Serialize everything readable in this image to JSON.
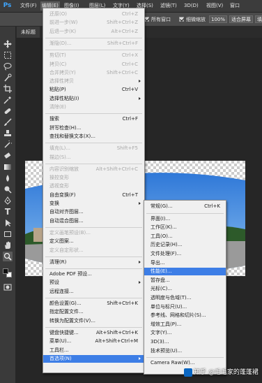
{
  "app_logo": "Ps",
  "menubar": {
    "items": [
      {
        "name": "menu-file",
        "label": "文件(F)"
      },
      {
        "name": "menu-edit",
        "label": "编辑(E)"
      },
      {
        "name": "menu-image",
        "label": "图像(I)"
      },
      {
        "name": "menu-layer",
        "label": "图层(L)"
      },
      {
        "name": "menu-type",
        "label": "文字(Y)"
      },
      {
        "name": "menu-select",
        "label": "选择(S)"
      },
      {
        "name": "menu-filter",
        "label": "滤镜(T)"
      },
      {
        "name": "menu-3d",
        "label": "3D(D)"
      },
      {
        "name": "menu-view",
        "label": "视图(V)"
      },
      {
        "name": "menu-window",
        "label": "窗口"
      }
    ]
  },
  "options_bar": {
    "all_windows": "所有窗口",
    "scrubby_zoom": "细微缩放",
    "zoom_value": "100%",
    "fit_screen": "适合屏幕",
    "fill_screen": "填充屏"
  },
  "document_tab": "未标题",
  "edit_menu": {
    "items": [
      {
        "label": "还原(O)",
        "shortcut": "Ctrl+Z",
        "disabled": true
      },
      {
        "label": "前进一步(W)",
        "shortcut": "Shift+Ctrl+Z",
        "disabled": true
      },
      {
        "label": "后退一步(K)",
        "shortcut": "Alt+Ctrl+Z",
        "disabled": true
      },
      {
        "sep": true
      },
      {
        "label": "渐隐(D)...",
        "shortcut": "Shift+Ctrl+F",
        "disabled": true
      },
      {
        "sep": true
      },
      {
        "label": "剪切(T)",
        "shortcut": "Ctrl+X",
        "disabled": true
      },
      {
        "label": "拷贝(C)",
        "shortcut": "Ctrl+C",
        "disabled": true
      },
      {
        "label": "合并拷贝(Y)",
        "shortcut": "Shift+Ctrl+C",
        "disabled": true
      },
      {
        "label": "选择性拷贝",
        "submenu": true,
        "disabled": true
      },
      {
        "label": "粘贴(P)",
        "shortcut": "Ctrl+V"
      },
      {
        "label": "选择性粘贴(I)",
        "submenu": true
      },
      {
        "label": "清除(E)",
        "disabled": true
      },
      {
        "sep": true
      },
      {
        "label": "搜索",
        "shortcut": "Ctrl+F"
      },
      {
        "label": "拼写检查(H)..."
      },
      {
        "label": "查找和替换文本(X)..."
      },
      {
        "sep": true
      },
      {
        "label": "填充(L)...",
        "shortcut": "Shift+F5",
        "disabled": true
      },
      {
        "label": "描边(S)...",
        "disabled": true
      },
      {
        "sep": true
      },
      {
        "label": "内容识别缩放",
        "shortcut": "Alt+Shift+Ctrl+C",
        "disabled": true
      },
      {
        "label": "操控变形",
        "disabled": true
      },
      {
        "label": "透视变形",
        "disabled": true
      },
      {
        "label": "自由变换(F)",
        "shortcut": "Ctrl+T"
      },
      {
        "label": "变换",
        "submenu": true
      },
      {
        "label": "自动对齐图层..."
      },
      {
        "label": "自动混合图层..."
      },
      {
        "sep": true
      },
      {
        "label": "定义画笔预设(B)...",
        "disabled": true
      },
      {
        "label": "定义图案..."
      },
      {
        "label": "定义自定形状...",
        "disabled": true
      },
      {
        "sep": true
      },
      {
        "label": "清理(R)",
        "submenu": true
      },
      {
        "sep": true
      },
      {
        "label": "Adobe PDF 预设..."
      },
      {
        "label": "预设",
        "submenu": true
      },
      {
        "label": "远程连接..."
      },
      {
        "sep": true
      },
      {
        "label": "颜色设置(G)...",
        "shortcut": "Shift+Ctrl+K"
      },
      {
        "label": "指定配置文件..."
      },
      {
        "label": "转换为配置文件(V)..."
      },
      {
        "sep": true
      },
      {
        "label": "键盘快捷键...",
        "shortcut": "Alt+Shift+Ctrl+K"
      },
      {
        "label": "菜单(U)...",
        "shortcut": "Alt+Shift+Ctrl+M"
      },
      {
        "label": "工具栏..."
      },
      {
        "label": "首选项(N)",
        "submenu": true,
        "highlighted": true
      }
    ]
  },
  "preferences_menu": {
    "items": [
      {
        "label": "常规(G)...",
        "shortcut": "Ctrl+K"
      },
      {
        "sep": true
      },
      {
        "label": "界面(I)..."
      },
      {
        "label": "工作区(K)..."
      },
      {
        "label": "工具(O)..."
      },
      {
        "label": "历史记录(H)..."
      },
      {
        "label": "文件处理(F)..."
      },
      {
        "label": "导出..."
      },
      {
        "label": "性能(E)...",
        "highlighted": true
      },
      {
        "label": "暂存盘..."
      },
      {
        "label": "光标(C)..."
      },
      {
        "label": "透明度与色域(T)..."
      },
      {
        "label": "单位与标尺(U)..."
      },
      {
        "label": "参考线、网格和切片(S)..."
      },
      {
        "label": "增效工具(P)..."
      },
      {
        "label": "文字(Y)..."
      },
      {
        "label": "3D(3)..."
      },
      {
        "label": "技术预览(U)..."
      },
      {
        "sep": true
      },
      {
        "label": "Camera Raw(W)..."
      }
    ]
  },
  "watermark": "知乎 @毛毛家的蓬蓬裙",
  "colors": {
    "highlight": "#3d7ee6",
    "menu_bg": "#f0f0f0",
    "logo": "#3fa6ff"
  }
}
